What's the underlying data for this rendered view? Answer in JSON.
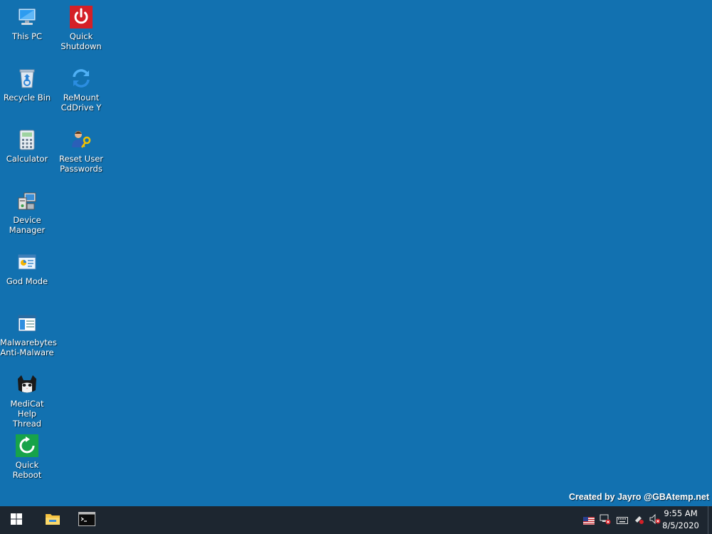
{
  "desktop": {
    "background_color": "#1271b0",
    "icons": [
      {
        "id": "this-pc",
        "label": "This PC",
        "icon": "computer-icon"
      },
      {
        "id": "quick-shutdown",
        "label": "Quick\nShutdown",
        "icon": "power-icon"
      },
      {
        "id": "recycle-bin",
        "label": "Recycle Bin",
        "icon": "recycle-bin-icon"
      },
      {
        "id": "remount-cddrive",
        "label": "ReMount\nCdDrive Y",
        "icon": "refresh-icon"
      },
      {
        "id": "calculator",
        "label": "Calculator",
        "icon": "calculator-icon"
      },
      {
        "id": "reset-user-passwords",
        "label": "Reset User\nPasswords",
        "icon": "user-key-icon"
      },
      {
        "id": "device-manager",
        "label": "Device\nManager",
        "icon": "device-manager-icon"
      },
      {
        "id": "god-mode",
        "label": "God Mode",
        "icon": "control-panel-icon"
      },
      {
        "id": "malwarebytes",
        "label": "Malwarebytes\nAnti-Malware",
        "icon": "window-app-icon"
      },
      {
        "id": "medicat-help",
        "label": "MediCat Help\nThread",
        "icon": "cat-icon"
      },
      {
        "id": "quick-reboot",
        "label": "Quick Reboot",
        "icon": "reboot-icon"
      }
    ],
    "watermark": "Created by Jayro @GBAtemp.net"
  },
  "taskbar": {
    "background_color": "#1d2630",
    "buttons": [
      {
        "id": "start",
        "icon": "windows-logo-icon"
      },
      {
        "id": "file-explorer",
        "icon": "folder-icon"
      },
      {
        "id": "terminal",
        "icon": "command-prompt-icon"
      }
    ],
    "tray": [
      {
        "id": "language",
        "icon": "us-flag-icon"
      },
      {
        "id": "network",
        "icon": "network-disconnected-icon"
      },
      {
        "id": "keyboard",
        "icon": "keyboard-icon"
      },
      {
        "id": "safely-remove",
        "icon": "usb-eject-icon"
      },
      {
        "id": "volume",
        "icon": "volume-muted-icon"
      }
    ],
    "clock": {
      "time": "9:55 AM",
      "date": "8/5/2020"
    }
  }
}
